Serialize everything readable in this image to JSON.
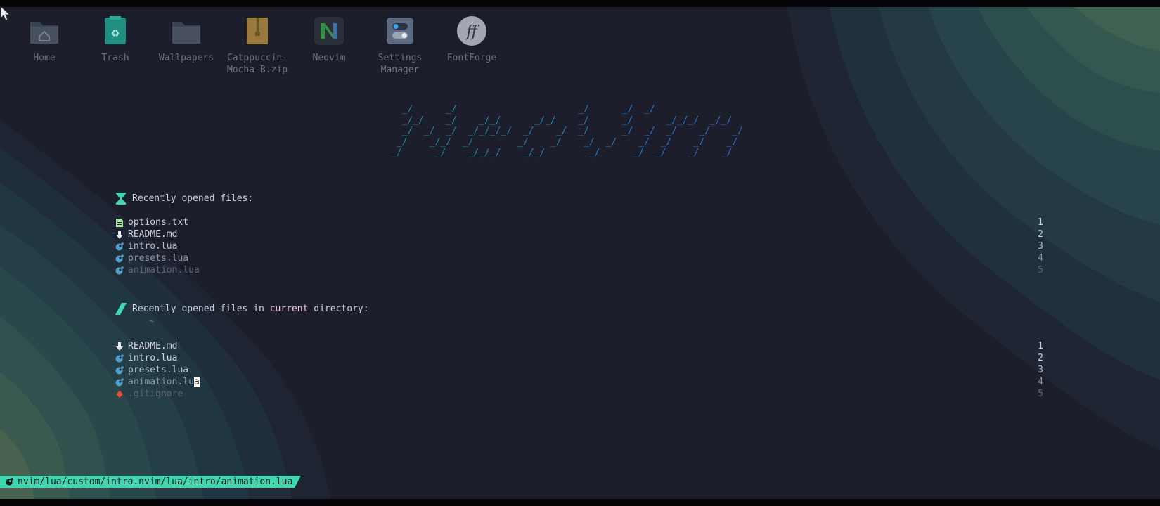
{
  "desktop_icons": [
    {
      "label": "Home",
      "icon": "home-folder-icon"
    },
    {
      "label": "Trash",
      "icon": "trash-icon"
    },
    {
      "label": "Wallpapers",
      "icon": "folder-icon"
    },
    {
      "label": "Catppuccin-\nMocha-B.zip",
      "icon": "zip-archive-icon"
    },
    {
      "label": "Neovim",
      "icon": "neovim-icon"
    },
    {
      "label": "Settings\nManager",
      "icon": "settings-toggle-icon"
    },
    {
      "label": "FontForge",
      "icon": "fontforge-icon"
    }
  ],
  "ascii_banner": [
    "  _/      _/                      _/      _/  _/",
    "  _/_/    _/    _/_/      _/_/    _/      _/      _/_/_/  _/_/",
    "  _/  _/  _/  _/_/_/_/  _/    _/  _/      _/  _/  _/    _/    _/",
    " _/    _/_/  _/        _/    _/    _/  _/    _/  _/    _/    _/",
    "_/      _/    _/_/_/    _/_/        _/      _/  _/    _/    _/"
  ],
  "recent": {
    "heading": "Recently opened files:",
    "files": [
      {
        "name": "options.txt",
        "num": "1"
      },
      {
        "name": "README.md",
        "num": "2"
      },
      {
        "name": "intro.lua",
        "num": "3"
      },
      {
        "name": "presets.lua",
        "num": "4"
      },
      {
        "name": "animation.lua",
        "num": "5"
      }
    ]
  },
  "recent_cwd": {
    "heading_prefix": "Recently opened files in ",
    "heading_highlight": "current",
    "heading_suffix": " directory:",
    "path": "~",
    "files": [
      {
        "name": "README.md",
        "num": "1"
      },
      {
        "name": "intro.lua",
        "num": "2"
      },
      {
        "name": "presets.lua",
        "num": "3"
      },
      {
        "name": "animation.lu",
        "cursor_char": "a",
        "num": "4"
      },
      {
        "name": ".gitignore",
        "num": "5"
      }
    ]
  },
  "statusline": {
    "path": "nvim/lua/custom/intro.nvim/lua/intro/animation.lua"
  },
  "colors": {
    "background": "#1c1e2b",
    "accent_teal": "#3fd6b0",
    "ascii_teal": "#1a8fa0",
    "ascii_blue": "#2e6fd8",
    "lua_blue": "#51a0cf",
    "git_orange": "#e84d31",
    "text_secondary_pink": "#f5c2e7"
  }
}
